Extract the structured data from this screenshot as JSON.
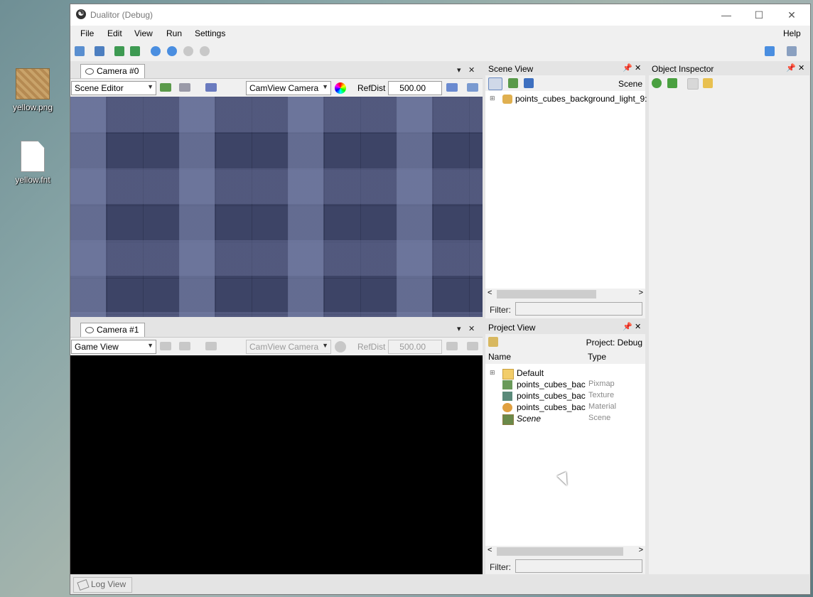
{
  "desktop": {
    "icons": [
      {
        "label": "yellow.png",
        "icon": "image-file-icon"
      },
      {
        "label": "yellow.fnt",
        "icon": "blank-file-icon"
      }
    ]
  },
  "window": {
    "title": "Dualitor (Debug)",
    "minimize": "—",
    "maximize": "☐",
    "close": "✕"
  },
  "menu": {
    "items": [
      "File",
      "Edit",
      "View",
      "Run",
      "Settings"
    ],
    "help": "Help"
  },
  "camera0": {
    "tab": "Camera #0",
    "mode": "Scene Editor",
    "camera": "CamView Camera",
    "refdist_label": "RefDist",
    "refdist": "500.00"
  },
  "camera1": {
    "tab": "Camera #1",
    "mode": "Game View",
    "camera": "CamView Camera",
    "refdist_label": "RefDist",
    "refdist": "500.00"
  },
  "scene_view": {
    "title": "Scene View",
    "scene_label": "Scene",
    "node": "points_cubes_background_light_9:",
    "filter_label": "Filter:"
  },
  "project_view": {
    "title": "Project View",
    "project_label": "Project: Debug",
    "col_name": "Name",
    "col_type": "Type",
    "items": [
      {
        "name": "Default",
        "type": "",
        "icon": "folder-icon"
      },
      {
        "name": "points_cubes_bac",
        "type": "Pixmap",
        "icon": "pixmap-icon"
      },
      {
        "name": "points_cubes_bac",
        "type": "Texture",
        "icon": "texture-icon"
      },
      {
        "name": "points_cubes_bac",
        "type": "Material",
        "icon": "material-icon"
      },
      {
        "name": "Scene",
        "type": "Scene",
        "icon": "scene-icon"
      }
    ],
    "filter_label": "Filter:"
  },
  "object_inspector": {
    "title": "Object Inspector"
  },
  "log": {
    "tab": "Log View"
  },
  "colors": {
    "accent": "#2b79c9",
    "viewport_bg": "#3d4466",
    "panel": "#f0f0f0"
  }
}
